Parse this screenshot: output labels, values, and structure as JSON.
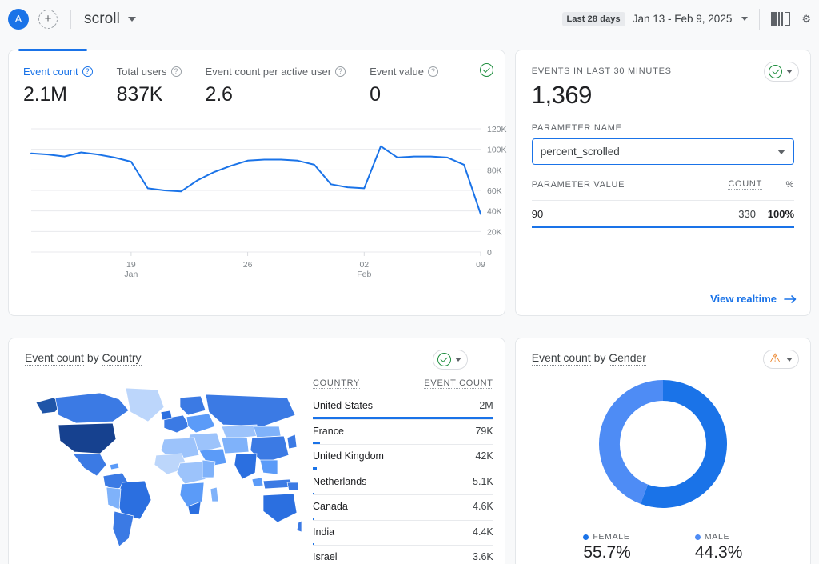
{
  "topbar": {
    "account_initial": "A",
    "add_label": "+",
    "property_name": "scroll",
    "date_chip": "Last 28 days",
    "date_range": "Jan 13 - Feb 9, 2025",
    "compare_icon": "comparison-icon",
    "settings_icon": "gear-icon"
  },
  "overview": {
    "metrics": [
      {
        "label": "Event count",
        "value": "2.1M",
        "primary": true
      },
      {
        "label": "Total users",
        "value": "837K",
        "primary": false
      },
      {
        "label": "Event count per active user",
        "value": "2.6",
        "primary": false
      },
      {
        "label": "Event value",
        "value": "0",
        "primary": false
      }
    ],
    "status_icon": "check-circle-icon"
  },
  "realtime": {
    "heading": "EVENTS IN LAST 30 MINUTES",
    "value": "1,369",
    "parameter_name_label": "PARAMETER NAME",
    "parameter_name_value": "percent_scrolled",
    "table": {
      "col_value": "PARAMETER VALUE",
      "col_count": "COUNT",
      "col_pct": "%",
      "rows": [
        {
          "value": "90",
          "count": "330",
          "pct": "100%",
          "bar": 100
        }
      ]
    },
    "view_link": "View realtime",
    "status_icon": "check-circle-icon"
  },
  "geo": {
    "title_metric": "Event count",
    "title_by": "by",
    "title_dimension": "Country",
    "status_icon": "check-circle-icon",
    "table": {
      "col_country": "COUNTRY",
      "col_event_count": "EVENT COUNT",
      "rows": [
        {
          "country": "United States",
          "value": "2M",
          "bar": 100
        },
        {
          "country": "France",
          "value": "79K",
          "bar": 3.9
        },
        {
          "country": "United Kingdom",
          "value": "42K",
          "bar": 2.1
        },
        {
          "country": "Netherlands",
          "value": "5.1K",
          "bar": 0.8
        },
        {
          "country": "Canada",
          "value": "4.6K",
          "bar": 0.7
        },
        {
          "country": "India",
          "value": "4.4K",
          "bar": 0.7
        },
        {
          "country": "Israel",
          "value": "3.6K",
          "bar": 0.6
        }
      ]
    }
  },
  "gender": {
    "title_metric": "Event count",
    "title_by": "by",
    "title_dimension": "Gender",
    "status_icon": "warning-triangle-icon",
    "legend": [
      {
        "label": "FEMALE",
        "value": "55.7%",
        "color": "#1a73e8"
      },
      {
        "label": "MALE",
        "value": "44.3%",
        "color": "#4e8cf5"
      }
    ]
  },
  "chart_data": {
    "type": "line",
    "title": "Event count over time",
    "xlabel": "",
    "ylabel": "Event count",
    "ylim": [
      0,
      120000
    ],
    "yticks": [
      0,
      20000,
      40000,
      60000,
      80000,
      100000,
      120000
    ],
    "ytick_labels": [
      "0",
      "20K",
      "40K",
      "60K",
      "80K",
      "100K",
      "120K"
    ],
    "xtick_labels": [
      "19\nJan",
      "26",
      "02\nFeb",
      "09"
    ],
    "xtick_index": [
      6,
      13,
      20,
      27
    ],
    "grid": true,
    "legend_position": "none",
    "line_color": "#1a73e8",
    "series": [
      {
        "name": "Event count",
        "values": [
          96000,
          95000,
          93000,
          97000,
          95000,
          92000,
          88000,
          62000,
          60000,
          59000,
          70000,
          78000,
          84000,
          89000,
          90000,
          90000,
          89000,
          85000,
          66000,
          63000,
          62000,
          103000,
          92000,
          93000,
          93000,
          92000,
          85000,
          37000
        ]
      }
    ],
    "secondary_charts": [
      {
        "type": "choropleth",
        "title": "Event count by Country",
        "categories": [
          "United States",
          "France",
          "United Kingdom",
          "Netherlands",
          "Canada",
          "India",
          "Israel"
        ],
        "values": [
          2000000,
          79000,
          42000,
          5100,
          4600,
          4400,
          3600
        ]
      },
      {
        "type": "pie",
        "title": "Event count by Gender",
        "categories": [
          "FEMALE",
          "MALE"
        ],
        "values": [
          55.7,
          44.3
        ],
        "colors": [
          "#1a73e8",
          "#4e8cf5"
        ]
      }
    ]
  }
}
